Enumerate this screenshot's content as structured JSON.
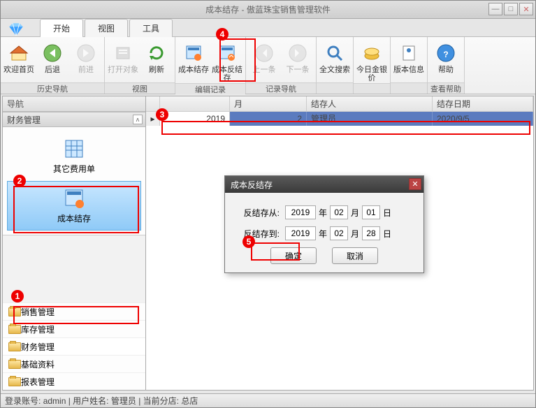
{
  "window": {
    "title": "成本结存 - 傲蓝珠宝销售管理软件"
  },
  "menu_tabs": [
    "开始",
    "视图",
    "工具"
  ],
  "ribbon_groups": [
    {
      "label": "历史导航",
      "buttons": [
        {
          "id": "home",
          "label": "欢迎首页",
          "disabled": false
        },
        {
          "id": "back",
          "label": "后退",
          "disabled": false
        },
        {
          "id": "fwd",
          "label": "前进",
          "disabled": true
        }
      ]
    },
    {
      "label": "视图",
      "buttons": [
        {
          "id": "open",
          "label": "打开对象",
          "disabled": true
        },
        {
          "id": "refresh",
          "label": "刷新",
          "disabled": false
        }
      ]
    },
    {
      "label": "编辑记录",
      "buttons": [
        {
          "id": "cost-save",
          "label": "成本结存",
          "disabled": false
        },
        {
          "id": "cost-reverse",
          "label": "成本反结存",
          "disabled": false
        }
      ]
    },
    {
      "label": "记录导航",
      "buttons": [
        {
          "id": "prev",
          "label": "上一条",
          "disabled": true
        },
        {
          "id": "next",
          "label": "下一条",
          "disabled": true
        }
      ]
    },
    {
      "label": "",
      "buttons": [
        {
          "id": "search",
          "label": "全文搜索",
          "disabled": false
        }
      ]
    },
    {
      "label": "",
      "buttons": [
        {
          "id": "gold",
          "label": "今日金银价",
          "disabled": false
        }
      ]
    },
    {
      "label": "",
      "buttons": [
        {
          "id": "ver",
          "label": "版本信息",
          "disabled": false
        }
      ]
    },
    {
      "label": "查看帮助",
      "buttons": [
        {
          "id": "help",
          "label": "帮助",
          "disabled": false
        }
      ]
    }
  ],
  "nav": {
    "title": "导航",
    "section": "财务管理",
    "items_big": [
      {
        "label": "其它费用单",
        "selected": false
      },
      {
        "label": "成本结存",
        "selected": true
      }
    ],
    "items_list": [
      {
        "label": "销售管理"
      },
      {
        "label": "库存管理"
      },
      {
        "label": "财务管理",
        "selected": true
      },
      {
        "label": "基础资料"
      },
      {
        "label": "报表管理"
      }
    ]
  },
  "grid": {
    "headers": [
      "",
      "",
      "月",
      "结存人",
      "结存日期"
    ],
    "row": {
      "marker": "▸",
      "year": "2019",
      "month": "2",
      "person": "管理员",
      "date": "2020/9/5"
    }
  },
  "dialog": {
    "title": "成本反结存",
    "from_label": "反结存从:",
    "to_label": "反结存到:",
    "year_unit": "年",
    "month_unit": "月",
    "day_unit": "日",
    "from": {
      "y": "2019",
      "m": "02",
      "d": "01"
    },
    "to": {
      "y": "2019",
      "m": "02",
      "d": "28"
    },
    "ok": "确定",
    "cancel": "取消"
  },
  "status": {
    "account_label": "登录账号:",
    "account": "admin",
    "name_label": "用户姓名:",
    "name": "管理员",
    "branch_label": "当前分店:",
    "branch": "总店",
    "sep": " | "
  },
  "callouts": [
    "1",
    "2",
    "3",
    "4",
    "5"
  ]
}
